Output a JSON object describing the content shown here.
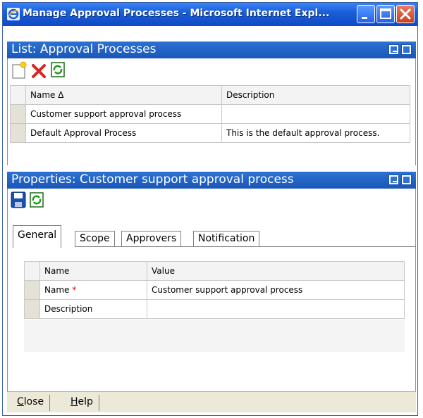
{
  "window": {
    "title": "Manage Approval Processes - Microsoft Internet Expl..."
  },
  "list_panel": {
    "title": "List: Approval Processes",
    "columns": [
      "Name Δ",
      "Description"
    ],
    "rows": [
      {
        "name": "Customer support approval process",
        "description": ""
      },
      {
        "name": "Default Approval Process",
        "description": "This is the default approval process."
      }
    ],
    "toolbar": [
      "new-icon",
      "delete-icon",
      "refresh-icon"
    ]
  },
  "properties_panel": {
    "title": "Properties: Customer support approval process",
    "toolbar": [
      "save-icon",
      "refresh-icon"
    ],
    "tabs": [
      "General",
      "Scope",
      "Approvers",
      "Notification"
    ],
    "active_tab": "General",
    "grid": {
      "columns": [
        "Name",
        "Value"
      ],
      "rows": [
        {
          "name": "Name",
          "required_marker": "*",
          "value": "Customer support approval process"
        },
        {
          "name": "Description",
          "required_marker": "",
          "value": ""
        }
      ]
    }
  },
  "footer": {
    "close_label": "Close",
    "help_label": "Help"
  },
  "colors": {
    "titlebar": "#1a5fd8",
    "panel_header": "#2c72d2",
    "required": "#e00000"
  }
}
